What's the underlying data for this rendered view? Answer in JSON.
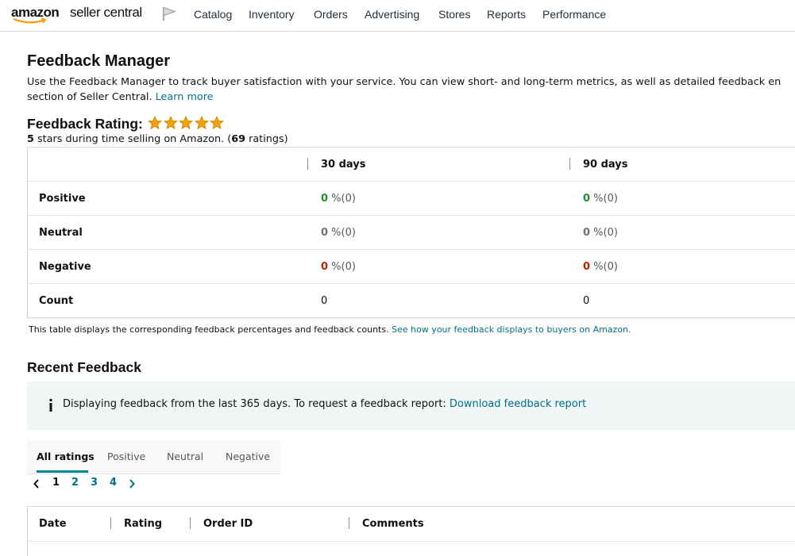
{
  "nav": {
    "logo_amazon": "amazon",
    "logo_sc": "seller central",
    "flag_icon": "flag-icon",
    "items": [
      "Catalog",
      "Inventory",
      "Orders",
      "Advertising",
      "Stores",
      "Reports",
      "Performance"
    ]
  },
  "page": {
    "title": "Feedback Manager",
    "intro_line1": "Use the Feedback Manager to track buyer satisfaction with your service. You can view short- and long-term metrics, as well as detailed feedback en",
    "intro_line2": "section of Seller Central.",
    "learn_more": "Learn more"
  },
  "rating": {
    "heading": "Feedback Rating:",
    "stars": 5,
    "star_icon": "star-icon",
    "star_color": "#f0a300",
    "sub_stars": "5",
    "sub_mid": " stars during time selling on Amazon. (",
    "sub_count": "69",
    "sub_end": " ratings)"
  },
  "metrics": {
    "columns": [
      "30 days",
      "90 days"
    ],
    "rows": [
      {
        "label": "Positive",
        "kind": "pos",
        "values": [
          {
            "num": "0",
            "pct": " %(0)"
          },
          {
            "num": "0",
            "pct": " %(0)"
          }
        ]
      },
      {
        "label": "Neutral",
        "kind": "neu",
        "values": [
          {
            "num": "0",
            "pct": " %(0)"
          },
          {
            "num": "0",
            "pct": " %(0)"
          }
        ]
      },
      {
        "label": "Negative",
        "kind": "neg",
        "values": [
          {
            "num": "0",
            "pct": " %(0)"
          },
          {
            "num": "0",
            "pct": " %(0)"
          }
        ]
      },
      {
        "label": "Count",
        "kind": "cnt",
        "values": [
          {
            "num": "0",
            "pct": ""
          },
          {
            "num": "0",
            "pct": ""
          }
        ]
      }
    ],
    "note": "This table displays the corresponding feedback percentages and feedback counts.",
    "note_link": "See how your feedback displays to buyers on Amazon."
  },
  "recent": {
    "title": "Recent Feedback",
    "info_icon": "info-icon",
    "info_text": "Displaying feedback from the last 365 days. To request a feedback report:",
    "info_link": "Download feedback report",
    "tabs": [
      "All ratings",
      "Positive",
      "Neutral",
      "Negative"
    ],
    "active_tab": "All ratings",
    "pages": [
      "1",
      "2",
      "3",
      "4"
    ],
    "current_page": "1",
    "columns": [
      "Date",
      "Rating",
      "Order ID",
      "Comments"
    ]
  },
  "colors": {
    "link": "#007185",
    "positive": "#1f8e2a",
    "negative": "#b12704",
    "tab_accent": "#008296",
    "info_bg": "#f0f5f5"
  }
}
